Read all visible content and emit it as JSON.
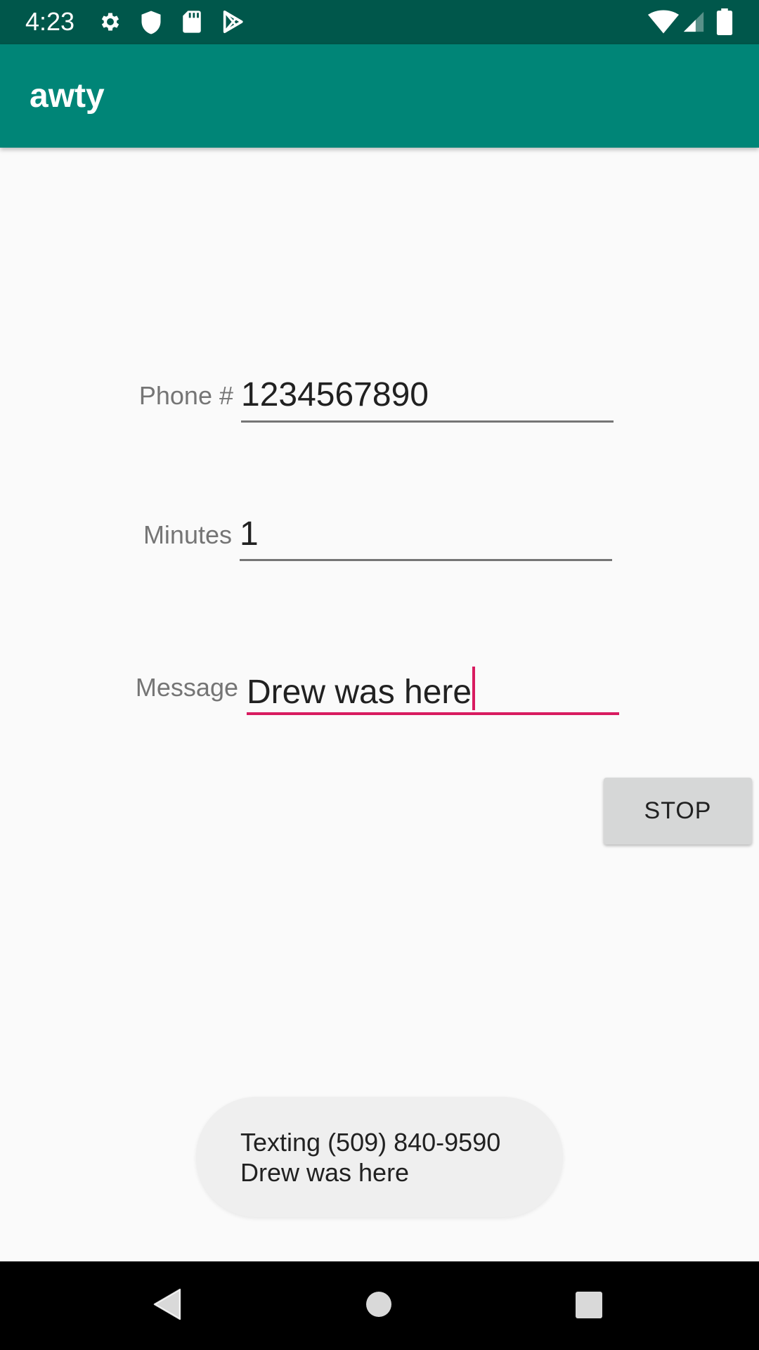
{
  "status_bar": {
    "time": "4:23",
    "left_icons": [
      "gear-icon",
      "shield-icon",
      "sd-card-icon",
      "play-store-icon"
    ],
    "right_icons": [
      "wifi-icon",
      "cell-signal-icon",
      "battery-icon"
    ],
    "background": "#00574b"
  },
  "app_bar": {
    "title": "awty",
    "background": "#008577"
  },
  "form": {
    "phone": {
      "label": "Phone #",
      "value": "1234567890"
    },
    "minutes": {
      "label": "Minutes",
      "value": "1"
    },
    "message": {
      "label": "Message",
      "value": "Drew was here"
    }
  },
  "stop_button": {
    "label": "STOP"
  },
  "toast": {
    "line1": "Texting (509) 840-9590",
    "line2": "Drew was here"
  },
  "nav_bar": {
    "icons": [
      "back-icon",
      "home-icon",
      "recents-icon"
    ]
  },
  "colors": {
    "accent": "#d81b60",
    "primary": "#008577",
    "primary_dark": "#00574b"
  }
}
